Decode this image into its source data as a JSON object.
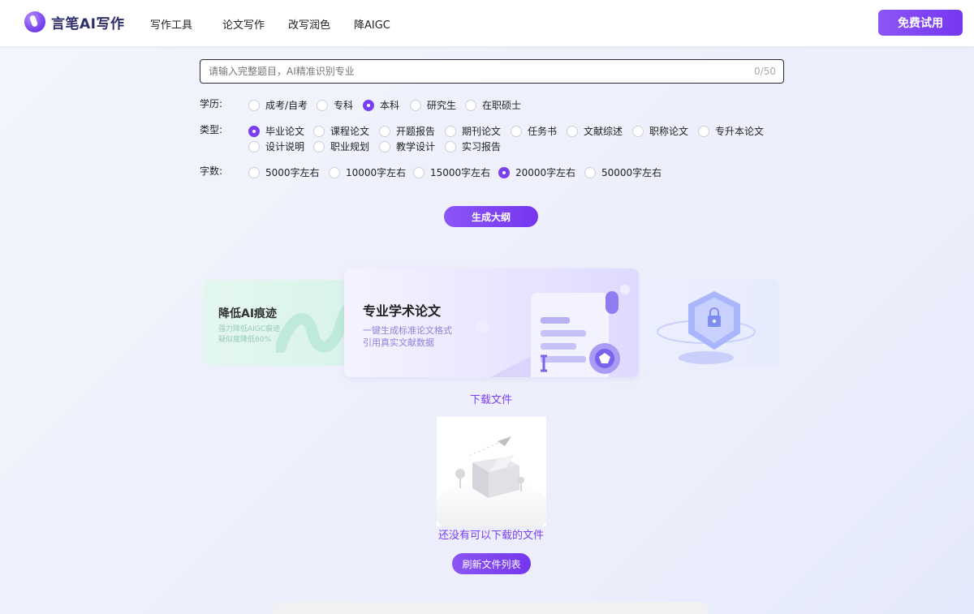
{
  "header": {
    "logo_text": "言笔AI写作",
    "nav": [
      "写作工具",
      "论文写作",
      "改写润色",
      "降AIGC"
    ],
    "trial_label": "免费试用"
  },
  "form": {
    "topic_placeholder": "请输入完整题目，AI精准识别专业",
    "topic_value": "",
    "counter": "0/50",
    "education": {
      "label": "学历:",
      "options": [
        "成考/自考",
        "专科",
        "本科",
        "研究生",
        "在职硕士"
      ],
      "selected": "本科"
    },
    "type": {
      "label": "类型:",
      "options": [
        "毕业论文",
        "课程论文",
        "开题报告",
        "期刊论文",
        "任务书",
        "文献综述",
        "职称论文",
        "专升本论文",
        "设计说明",
        "职业规划",
        "教学设计",
        "实习报告"
      ],
      "selected": "毕业论文"
    },
    "words": {
      "label": "字数:",
      "options": [
        "5000字左右",
        "10000字左右",
        "15000字左右",
        "20000字左右",
        "50000字左右"
      ],
      "selected": "20000字左右"
    },
    "generate_label": "生成大纲"
  },
  "carousel": {
    "left": {
      "title": "降低AI痕迹",
      "lines": [
        "强力降低AIGC痕迹",
        "疑似度降低60%"
      ]
    },
    "center": {
      "title": "专业学术论文",
      "lines": [
        "一键生成标准论文格式",
        "引用真实文献数据"
      ]
    }
  },
  "download": {
    "title": "下载文件",
    "empty_text": "还没有可以下载的文件",
    "refresh_label": "刷新文件列表"
  },
  "colors": {
    "accent": "#7a3ff0",
    "accent_light": "#8b55f6"
  }
}
